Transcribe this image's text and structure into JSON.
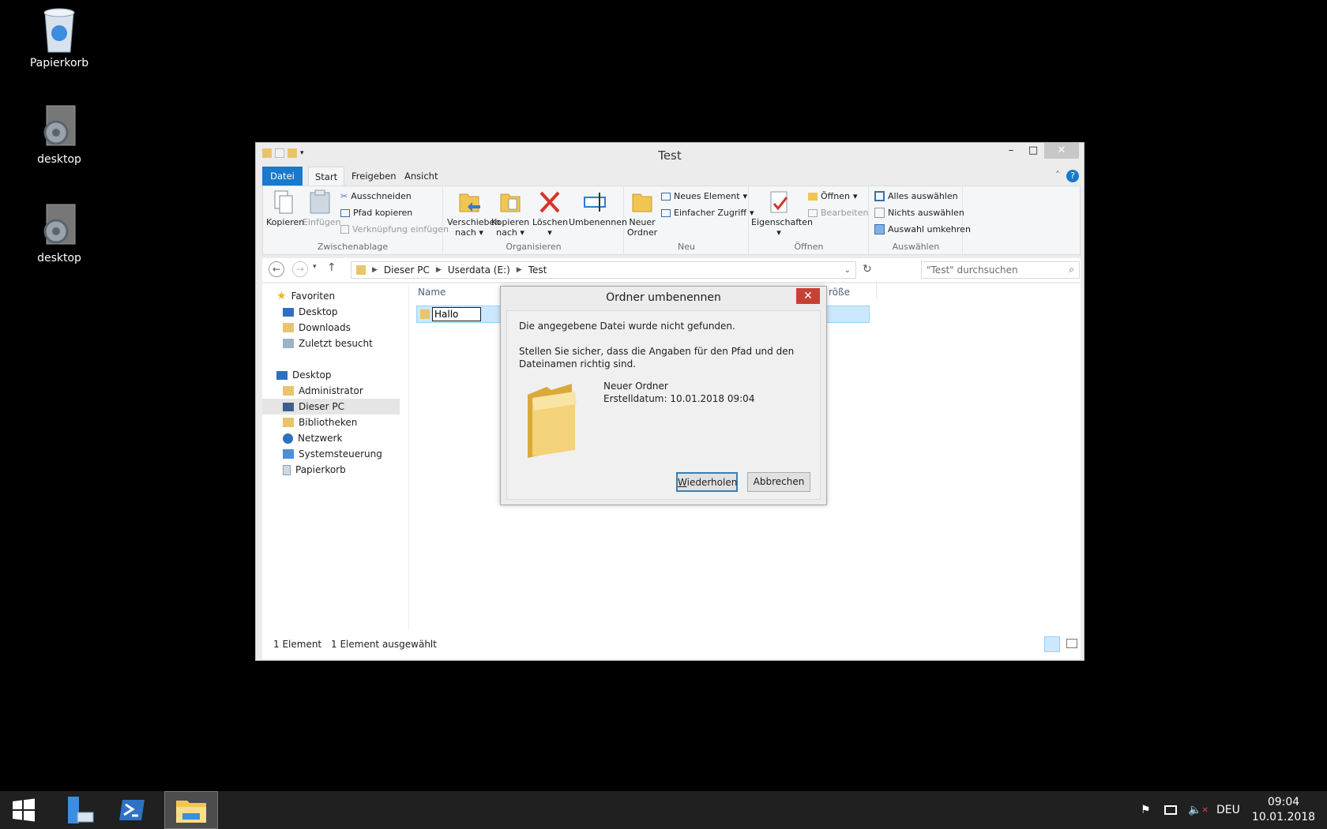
{
  "desktop": {
    "icons": [
      {
        "label": "Papierkorb"
      },
      {
        "label": "desktop"
      },
      {
        "label": "desktop"
      }
    ]
  },
  "window": {
    "title": "Test",
    "tabs": {
      "file": "Datei",
      "start": "Start",
      "share": "Freigeben",
      "view": "Ansicht"
    },
    "ribbon": {
      "clipboard": {
        "label": "Zwischenablage",
        "copy": "Kopieren",
        "paste": "Einfügen",
        "cut": "Ausschneiden",
        "copy_path": "Pfad kopieren",
        "paste_shortcut": "Verknüpfung einfügen"
      },
      "organize": {
        "label": "Organisieren",
        "move_to_1": "Verschieben",
        "move_to_2": "nach",
        "copy_to_1": "Kopieren",
        "copy_to_2": "nach",
        "delete": "Löschen",
        "rename": "Umbenennen"
      },
      "new": {
        "label": "Neu",
        "new_folder_1": "Neuer",
        "new_folder_2": "Ordner",
        "new_item": "Neues Element",
        "easy_access": "Einfacher Zugriff"
      },
      "open": {
        "label": "Öffnen",
        "properties": "Eigenschaften",
        "open": "Öffnen",
        "edit": "Bearbeiten"
      },
      "select": {
        "label": "Auswählen",
        "select_all": "Alles auswählen",
        "select_none": "Nichts auswählen",
        "invert": "Auswahl umkehren"
      }
    },
    "address": {
      "crumbs": [
        "Dieser PC",
        "Userdata (E:)",
        "Test"
      ],
      "search_placeholder": "\"Test\" durchsuchen"
    },
    "nav": {
      "favorites": "Favoriten",
      "fav_items": [
        "Desktop",
        "Downloads",
        "Zuletzt besucht"
      ],
      "desktop": "Desktop",
      "desktop_items": [
        "Administrator",
        "Dieser PC",
        "Bibliotheken",
        "Netzwerk",
        "Systemsteuerung",
        "Papierkorb"
      ]
    },
    "files": {
      "col_name": "Name",
      "col_size": "röße",
      "rename_value": "Hallo"
    },
    "status": {
      "count": "1 Element",
      "selected": "1 Element ausgewählt"
    }
  },
  "dialog": {
    "title": "Ordner umbenennen",
    "message1": "Die angegebene Datei wurde nicht gefunden.",
    "message2": "Stellen Sie sicher, dass die Angaben für den Pfad und den Dateinamen richtig sind.",
    "item_name": "Neuer Ordner",
    "item_date": "Erstelldatum: 10.01.2018 09:04",
    "retry_label_u": "W",
    "retry_label_rest": "iederholen",
    "cancel_label": "Abbrechen"
  },
  "taskbar": {
    "lang": "DEU",
    "time": "09:04",
    "date": "10.01.2018"
  }
}
